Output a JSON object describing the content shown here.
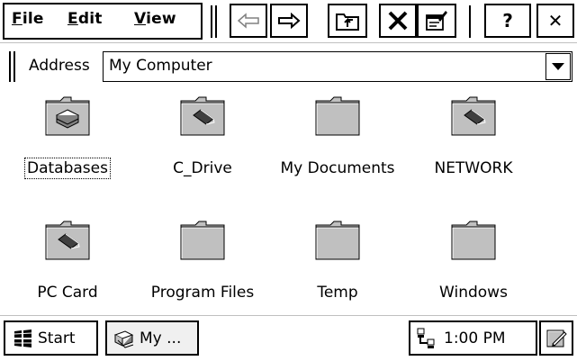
{
  "menu": {
    "file": {
      "hot": "F",
      "rest": "ile"
    },
    "edit": {
      "hot": "E",
      "rest": "dit"
    },
    "view": {
      "hot": "V",
      "rest": "iew"
    }
  },
  "toolbar": {
    "icons": [
      "back-icon",
      "forward-icon",
      "up-folder-icon",
      "delete-icon",
      "properties-icon",
      "help-icon",
      "close-icon"
    ],
    "help_label": "?",
    "close_label": "✕"
  },
  "address": {
    "label": "Address",
    "value": "My Computer"
  },
  "items": [
    {
      "label": "Databases",
      "icon": "database-folder-icon",
      "selected": true
    },
    {
      "label": "C_Drive",
      "icon": "storage-card-folder-icon"
    },
    {
      "label": "My Documents",
      "icon": "folder-icon"
    },
    {
      "label": "NETWORK",
      "icon": "storage-card-folder-icon"
    },
    {
      "label": "PC Card",
      "icon": "storage-card-folder-icon"
    },
    {
      "label": "Program Files",
      "icon": "folder-icon"
    },
    {
      "label": "Temp",
      "icon": "folder-icon"
    },
    {
      "label": "Windows",
      "icon": "folder-icon"
    }
  ],
  "taskbar": {
    "start_label": "Start",
    "task_label": "My ...",
    "time": "1:00 PM"
  }
}
